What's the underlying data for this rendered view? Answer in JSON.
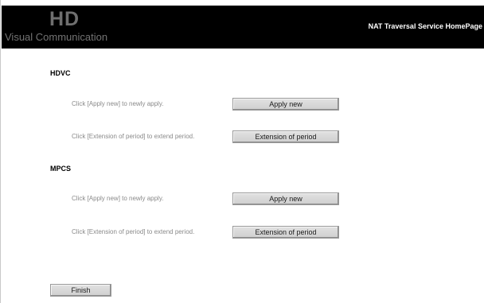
{
  "header": {
    "logo_mark": "HD",
    "logo_text": "Visual Communication",
    "title": "NAT Traversal Service HomePage"
  },
  "sections": [
    {
      "heading": "HDVC",
      "rows": [
        {
          "instruction": "Click [Apply new] to newly apply.",
          "button": "Apply new"
        },
        {
          "instruction": "Click [Extension of period] to extend period.",
          "button": "Extension of period"
        }
      ]
    },
    {
      "heading": "MPCS",
      "rows": [
        {
          "instruction": "Click [Apply new] to newly apply.",
          "button": "Apply new"
        },
        {
          "instruction": "Click [Extension of period] to extend period.",
          "button": "Extension of period"
        }
      ]
    }
  ],
  "finish_label": "Finish"
}
